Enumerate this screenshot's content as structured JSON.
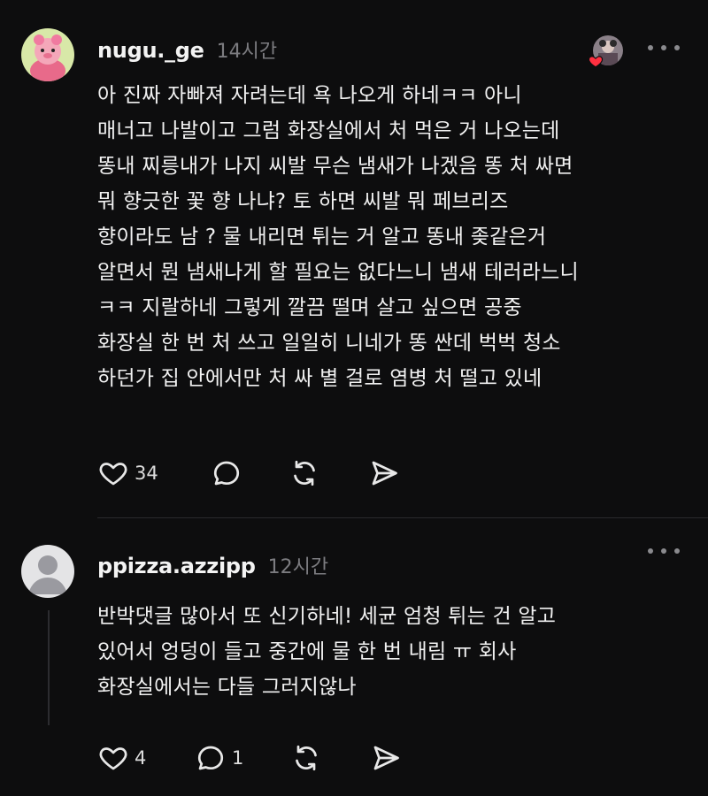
{
  "posts": [
    {
      "username": "nugu._ge",
      "time": "14시간",
      "lines": [
        "아 진짜 자빠져 자려는데 욕 나오게 하네ㅋㅋ 아니",
        "매너고 나발이고 그럼 화장실에서 처 먹은 거 나오는데",
        "똥내 찌릉내가 나지 씨발 무슨 냄새가 나겠음 똥 처 싸면",
        "뭐 향긋한 꽃 향 나냐? 토 하면 씨발 뭐 페브리즈",
        "향이라도 남 ? 물 내리면 튀는 거 알고 똥내 좆같은거",
        "알면서 뭔 냄새나게 할 필요는 없다느니 냄새 테러라느니",
        "ㅋㅋ 지랄하네 그렇게 깔끔 떨며 살고 싶으면 공중",
        "화장실 한 번 처 쓰고 일일히 니네가 똥 싼데 벅벅 청소",
        "하던가 집 안에서만 처 싸 별 걸로 염병 처 떨고 있네"
      ],
      "likes": "34",
      "icons": [
        "heart-icon",
        "reply-icon",
        "repost-icon",
        "share-icon"
      ]
    },
    {
      "username": "ppizza.azzipp",
      "time": "12시간",
      "lines": [
        "반박댓글 많아서 또 신기하네! 세균 엄청 튀는 건 알고",
        "있어서 엉덩이 들고 중간에 물 한 번 내림 ㅠ 회사",
        "화장실에서는 다들 그러지않나"
      ],
      "likes": "4",
      "replies": "1",
      "icons": [
        "heart-icon",
        "reply-icon",
        "repost-icon",
        "share-icon"
      ]
    }
  ],
  "colors": {
    "background": "#0d0d0e",
    "text": "#f3f3f3",
    "muted": "#7c7c80",
    "like_heart": "#ff3040"
  }
}
